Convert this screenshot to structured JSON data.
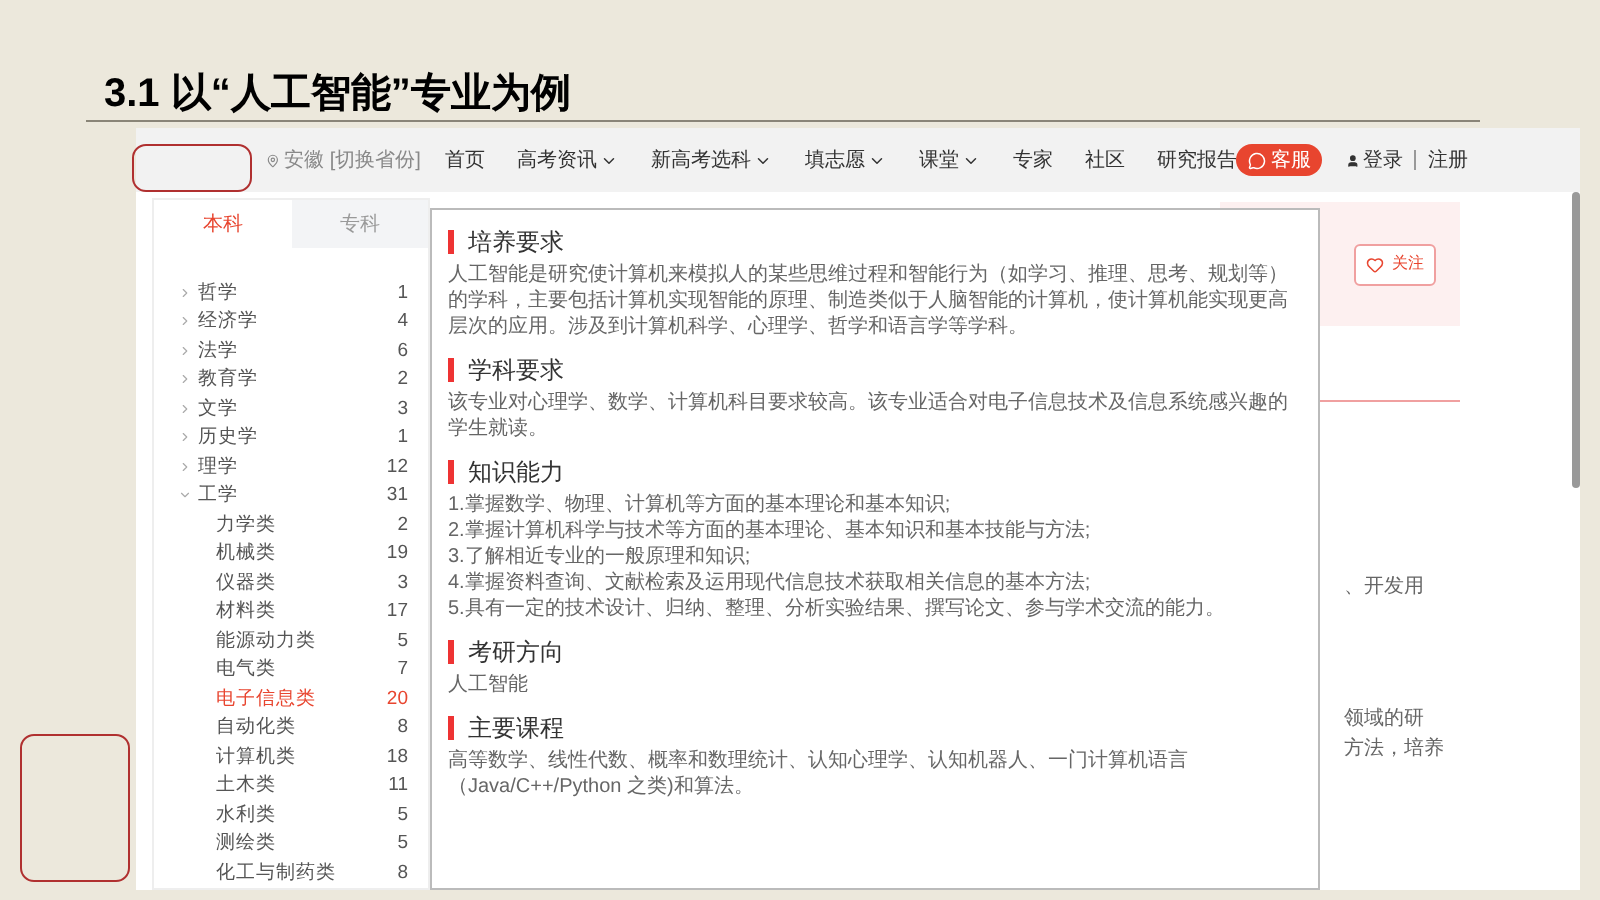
{
  "slide_title": "3.1 以“人工智能”专业为例",
  "nav": {
    "location": "安徽",
    "switch": "[切换省份]",
    "items": [
      {
        "label": "首页",
        "dropdown": false
      },
      {
        "label": "高考资讯",
        "dropdown": true
      },
      {
        "label": "新高考选科",
        "dropdown": true
      },
      {
        "label": "填志愿",
        "dropdown": true
      },
      {
        "label": "课堂",
        "dropdown": true
      },
      {
        "label": "专家",
        "dropdown": false
      },
      {
        "label": "社区",
        "dropdown": false
      },
      {
        "label": "研究报告",
        "dropdown": false
      }
    ],
    "service": "客服",
    "login": "登录",
    "register": "注册"
  },
  "tabs": [
    {
      "label": "本科",
      "selected": true
    },
    {
      "label": "专科",
      "selected": false
    }
  ],
  "categories": [
    {
      "name": "哲学",
      "count": "1",
      "expanded": false
    },
    {
      "name": "经济学",
      "count": "4",
      "expanded": false
    },
    {
      "name": "法学",
      "count": "6",
      "expanded": false
    },
    {
      "name": "教育学",
      "count": "2",
      "expanded": false
    },
    {
      "name": "文学",
      "count": "3",
      "expanded": false
    },
    {
      "name": "历史学",
      "count": "1",
      "expanded": false
    },
    {
      "name": "理学",
      "count": "12",
      "expanded": false
    },
    {
      "name": "工学",
      "count": "31",
      "expanded": true,
      "children": [
        {
          "name": "力学类",
          "count": "2",
          "selected": false
        },
        {
          "name": "机械类",
          "count": "19",
          "selected": false
        },
        {
          "name": "仪器类",
          "count": "3",
          "selected": false
        },
        {
          "name": "材料类",
          "count": "17",
          "selected": false
        },
        {
          "name": "能源动力类",
          "count": "5",
          "selected": false
        },
        {
          "name": "电气类",
          "count": "7",
          "selected": false
        },
        {
          "name": "电子信息类",
          "count": "20",
          "selected": true
        },
        {
          "name": "自动化类",
          "count": "8",
          "selected": false
        },
        {
          "name": "计算机类",
          "count": "18",
          "selected": false
        },
        {
          "name": "土木类",
          "count": "11",
          "selected": false
        },
        {
          "name": "水利类",
          "count": "5",
          "selected": false
        },
        {
          "name": "测绘类",
          "count": "5",
          "selected": false
        },
        {
          "name": "化工与制药类",
          "count": "8",
          "selected": false
        }
      ]
    }
  ],
  "popup": {
    "sections": [
      {
        "heading": "培养要求",
        "lines": [
          "人工智能是研究使计算机来模拟人的某些思维过程和智能行为（如学习、推理、思考、规划等）的学科，主要包括计算机实现智能的原理、制造类似于人脑智能的计算机，使计算机能实现更高层次的应用。涉及到计算机科学、心理学、哲学和语言学等学科。"
        ]
      },
      {
        "heading": "学科要求",
        "lines": [
          "该专业对心理学、数学、计算机科目要求较高。该专业适合对电子信息技术及信息系统感兴趣的学生就读。"
        ]
      },
      {
        "heading": "知识能力",
        "lines": [
          "1.掌握数学、物理、计算机等方面的基本理论和基本知识;",
          "2.掌握计算机科学与技术等方面的基本理论、基本知识和基本技能与方法;",
          "3.了解相近专业的一般原理和知识;",
          "4.掌握资料查询、文献检索及运用现代信息技术获取相关信息的基本方法;",
          "5.具有一定的技术设计、归纳、整理、分析实验结果、撰写论文、参与学术交流的能力。"
        ]
      },
      {
        "heading": "考研方向",
        "lines": [
          "人工智能"
        ]
      },
      {
        "heading": "主要课程",
        "lines": [
          "高等数学、线性代数、概率和数理统计、认知心理学、认知机器人、一门计算机语言（Java/C++/Python 之类)和算法。"
        ]
      }
    ]
  },
  "background": {
    "follow": "关注",
    "fragments": [
      "、开发用",
      "领域的研",
      "方法，培养"
    ]
  }
}
